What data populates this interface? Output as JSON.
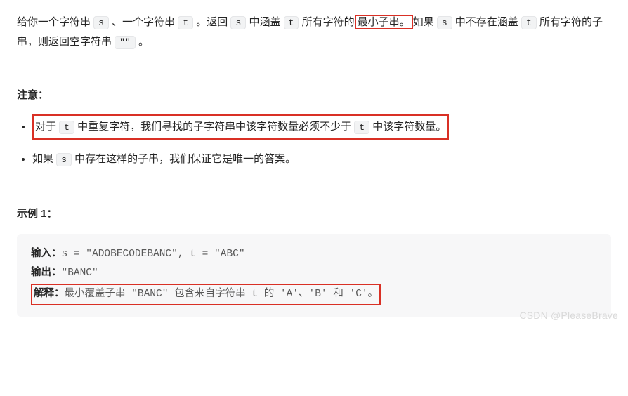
{
  "intro": {
    "p1a": "给你一个字符串 ",
    "code_s": "s",
    "p1b": " 、一个字符串 ",
    "code_t": "t",
    "p1c": " 。返回 ",
    "code_s2": "s",
    "p1d": " 中涵盖 ",
    "code_t2": "t",
    "p1e": " 所有字符的",
    "highlight": "最小子串。",
    "p1f": "如果 ",
    "code_s3": "s",
    "p1g": " 中不存在涵盖 ",
    "code_t3": "t",
    "p1h": " 所有字符的子串，则返回空字符串 ",
    "code_empty": "\"\"",
    "p1i": " 。"
  },
  "notice": {
    "title": "注意：",
    "item1": {
      "a": "对于 ",
      "code_t": "t",
      "b": " 中重复字符，我们寻找的子字符串中该字符数量必须不少于 ",
      "code_t2": "t",
      "c": " 中该字符数量。"
    },
    "item2": {
      "a": "如果 ",
      "code_s": "s",
      "b": " 中存在这样的子串，我们保证它是唯一的答案。"
    }
  },
  "example": {
    "title": "示例 1：",
    "input_label": "输入：",
    "input_value": "s = \"ADOBECODEBANC\", t = \"ABC\"",
    "output_label": "输出：",
    "output_value": "\"BANC\"",
    "explain_label": "解释：",
    "explain_value": "最小覆盖子串 \"BANC\" 包含来自字符串 t 的 'A'、'B' 和 'C'。"
  },
  "watermark": "CSDN @PleaseBrave"
}
